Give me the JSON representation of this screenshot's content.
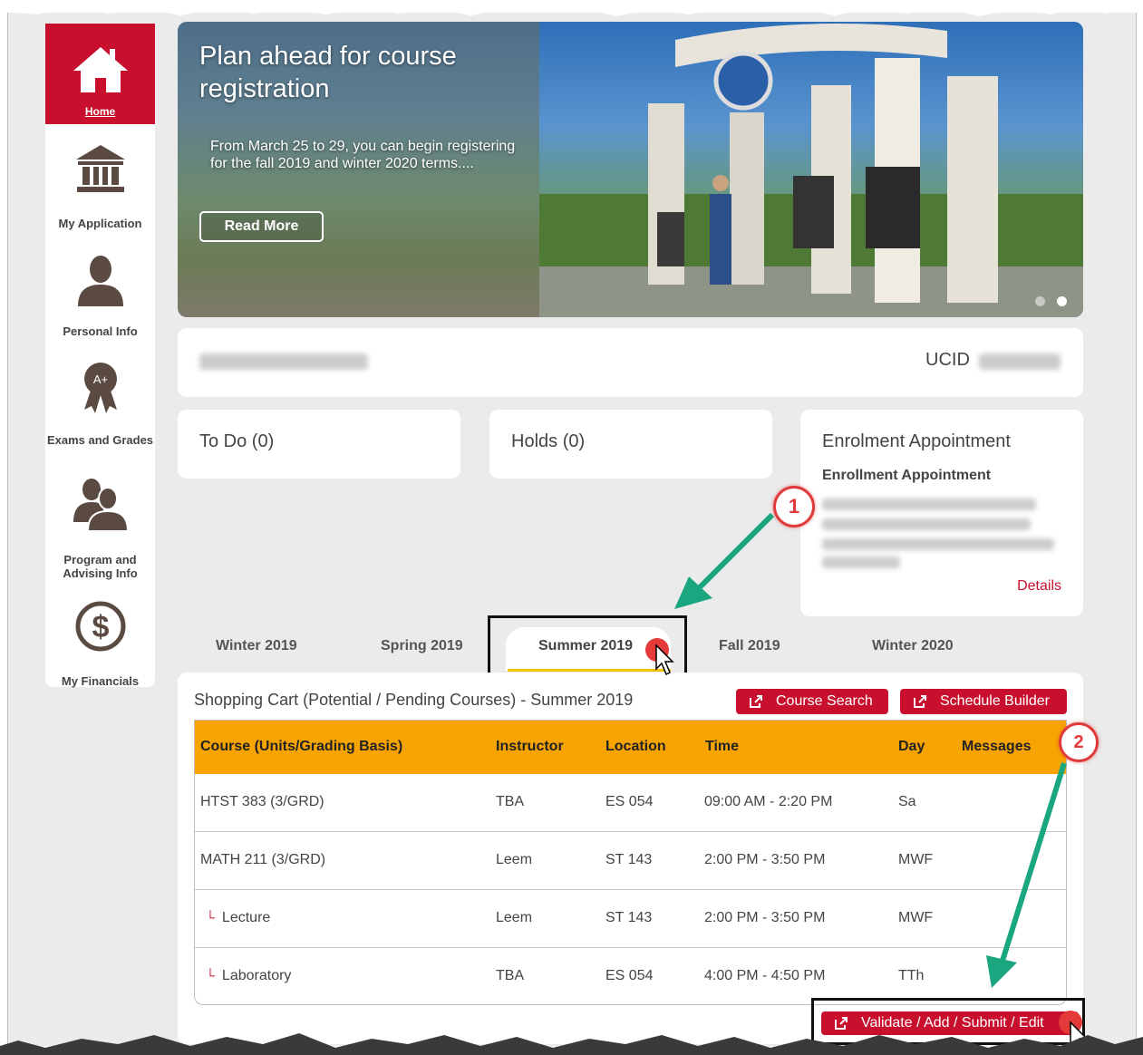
{
  "sidebar": {
    "items": [
      {
        "label": "Home",
        "icon": "home-icon"
      },
      {
        "label": "My Application",
        "icon": "institution-icon"
      },
      {
        "label": "Personal Info",
        "icon": "person-icon"
      },
      {
        "label": "Exams and Grades",
        "icon": "award-ribbon-icon",
        "badge": "A+"
      },
      {
        "label": "Program and Advising Info",
        "icon": "advisors-icon"
      },
      {
        "label": "My Financials",
        "icon": "dollar-icon",
        "glyph": "$"
      }
    ]
  },
  "banner": {
    "title": "Plan ahead for course registration",
    "body": "From March 25 to 29, you can begin registering for the fall 2019 and winter 2020 terms....",
    "button": "Read More"
  },
  "profile": {
    "ucid_label": "UCID"
  },
  "cards": {
    "todo": "To Do (0)",
    "holds": "Holds (0)",
    "enrolment_title": "Enrolment Appointment",
    "enrolment_subtitle": "Enrollment Appointment",
    "details_link": "Details"
  },
  "terms": {
    "tabs": [
      "Winter 2019",
      "Spring 2019",
      "Summer 2019",
      "Fall 2019",
      "Winter 2020"
    ],
    "active": "Summer 2019"
  },
  "cart": {
    "title": "Shopping Cart (Potential / Pending Courses) - Summer 2019",
    "course_search": "Course Search",
    "schedule_builder": "Schedule Builder",
    "submit": "Validate / Add / Submit / Edit",
    "columns": [
      "Course (Units/Grading Basis)",
      "Instructor",
      "Location",
      "Time",
      "Day",
      "Messages"
    ],
    "sub_marker": "└",
    "rows": [
      {
        "course": "HTST 383 (3/GRD)",
        "instructor": "TBA",
        "location": "ES 054",
        "time": "09:00 AM - 2:20 PM",
        "day": "Sa"
      },
      {
        "course": "MATH 211 (3/GRD)",
        "instructor": "Leem",
        "location": "ST 143",
        "time": "2:00 PM - 3:50 PM",
        "day": "MWF"
      },
      {
        "course": "Lecture",
        "instructor": "Leem",
        "location": "ST 143",
        "time": "2:00 PM - 3:50 PM",
        "day": "MWF",
        "sub": true
      },
      {
        "course": "Laboratory",
        "instructor": "TBA",
        "location": "ES 054",
        "time": "4:00 PM - 4:50 PM",
        "day": "TTh",
        "sub": true
      }
    ]
  },
  "callouts": [
    "1",
    "2"
  ],
  "colors": {
    "brand_red": "#c8102e",
    "header_orange": "#f7a400",
    "tab_underline": "#f2c200",
    "arrow_teal": "#1aa67f"
  }
}
